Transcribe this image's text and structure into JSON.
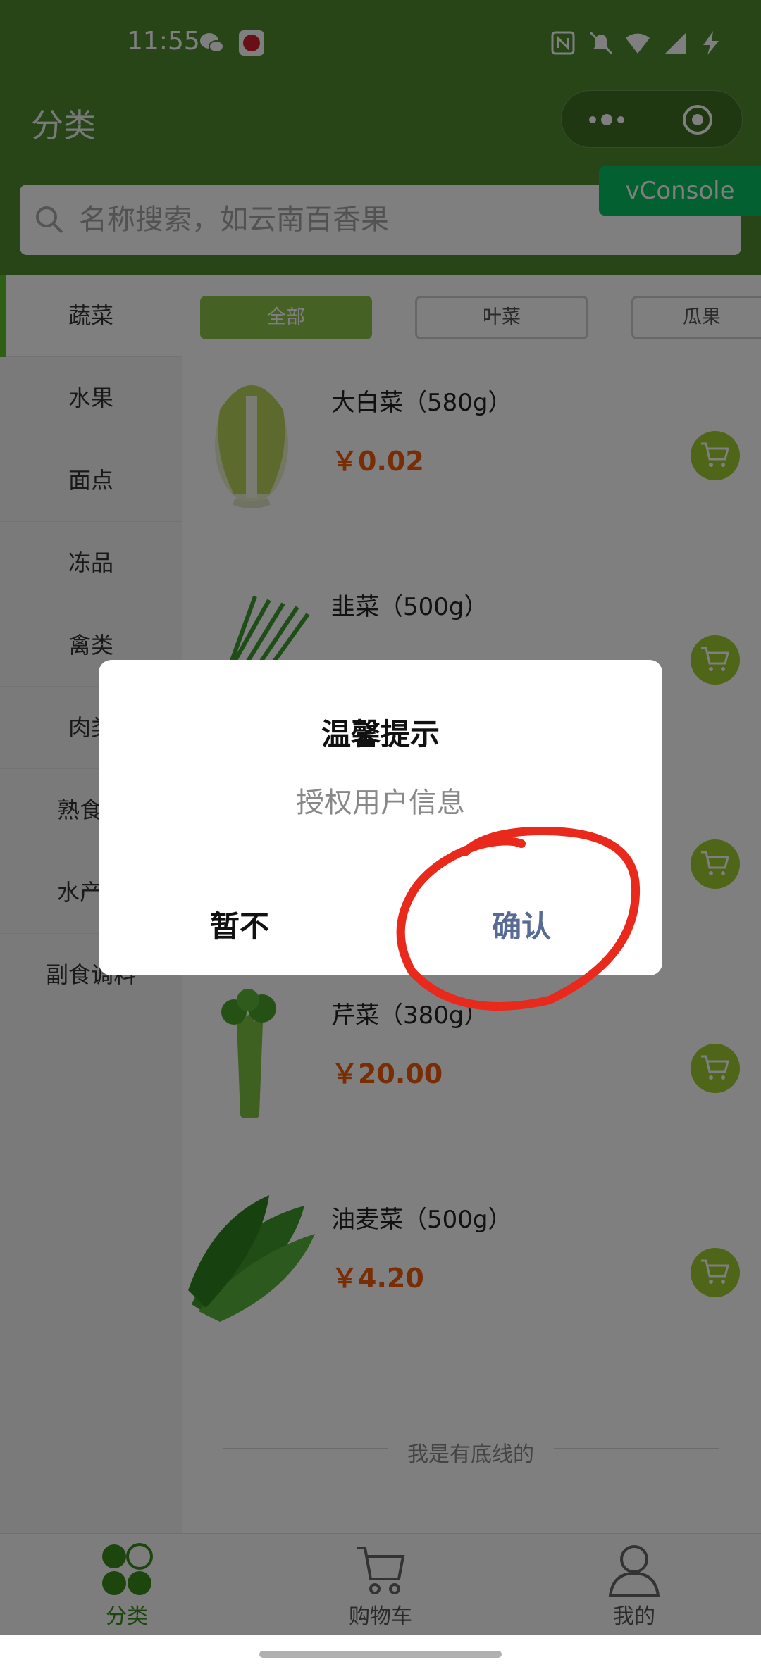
{
  "status_bar": {
    "time": "11:55"
  },
  "nav": {
    "title": "分类"
  },
  "vconsole": "vConsole",
  "search": {
    "placeholder": "名称搜索，如云南百香果"
  },
  "sidebar": {
    "items": [
      {
        "label": "蔬菜",
        "active": true
      },
      {
        "label": "水果"
      },
      {
        "label": "面点"
      },
      {
        "label": "冻品"
      },
      {
        "label": "禽类"
      },
      {
        "label": "肉类"
      },
      {
        "label": "熟食原"
      },
      {
        "label": "水产品"
      },
      {
        "label": "副食调料"
      }
    ]
  },
  "chips": [
    {
      "label": "全部",
      "active": true
    },
    {
      "label": "叶菜"
    },
    {
      "label": "瓜果"
    }
  ],
  "products": [
    {
      "name": "大白菜（580g）",
      "price": "￥0.02"
    },
    {
      "name": "韭菜（500g）",
      "price": ""
    },
    {
      "name": "",
      "price": ""
    },
    {
      "name": "芹菜（380g）",
      "price": "￥20.00"
    },
    {
      "name": "油麦菜（500g）",
      "price": "￥4.20"
    }
  ],
  "footer_note": "我是有底线的",
  "tabbar": [
    {
      "label": "分类",
      "icon": "category-icon",
      "active": true
    },
    {
      "label": "购物车",
      "icon": "cart-icon"
    },
    {
      "label": "我的",
      "icon": "user-icon"
    }
  ],
  "dialog": {
    "title": "温馨提示",
    "message": "授权用户信息",
    "cancel": "暂不",
    "confirm": "确认"
  },
  "colors": {
    "header": "#4e8a2c",
    "price": "#f05a0a",
    "confirm": "#576b95",
    "cart": "#9ecb2f",
    "annotation": "#e8291c"
  }
}
